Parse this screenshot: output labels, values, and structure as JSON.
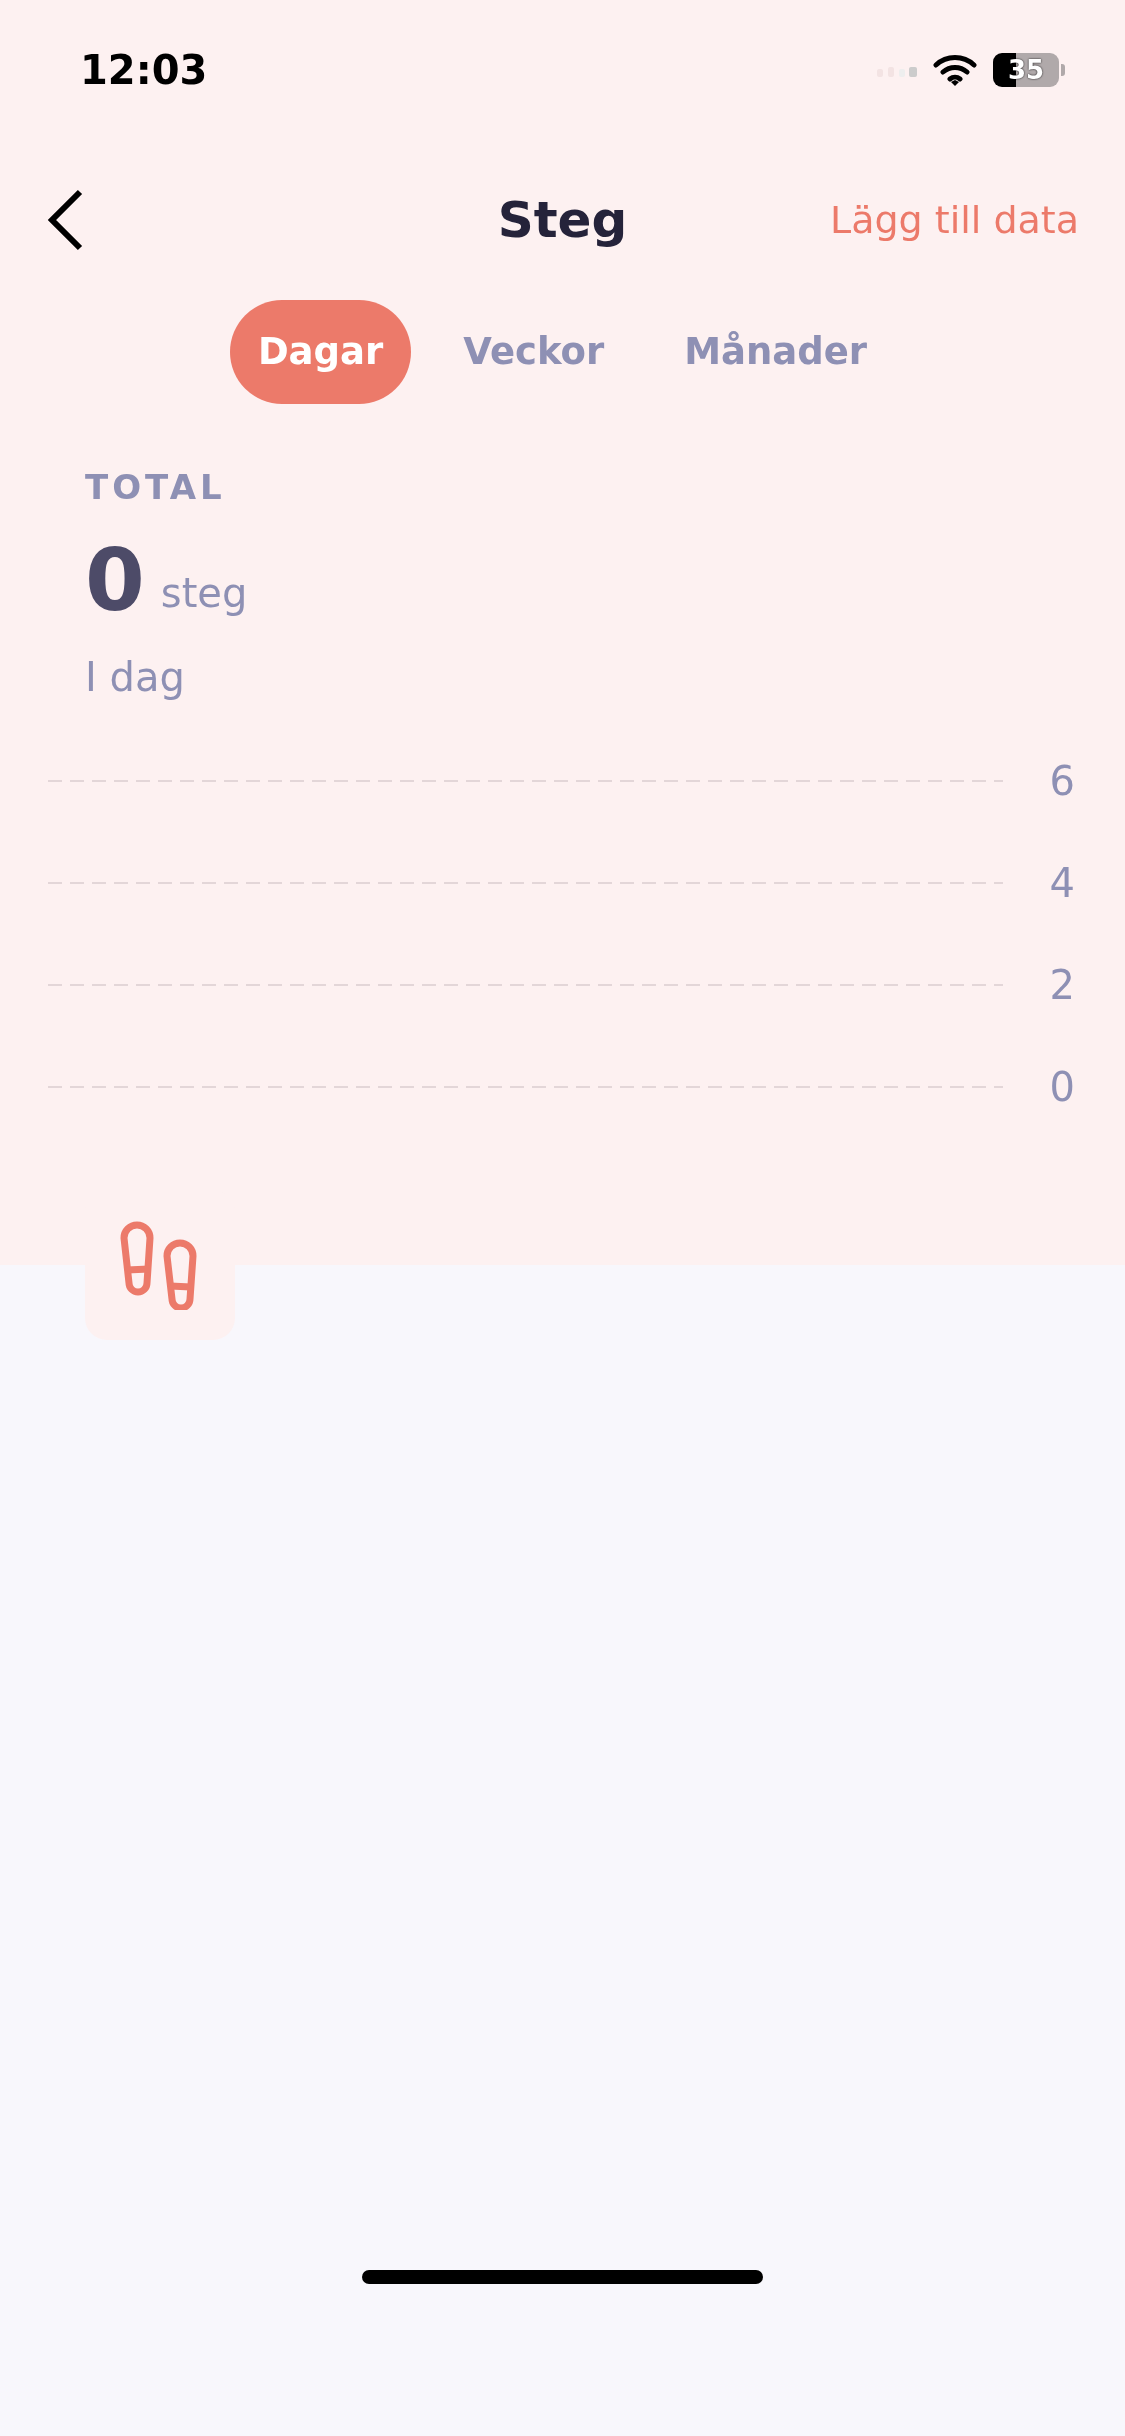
{
  "status_bar": {
    "time": "12:03",
    "battery": "35"
  },
  "header": {
    "title": "Steg",
    "action": "Lägg till data"
  },
  "tabs": [
    {
      "label": "Dagar",
      "selected": true
    },
    {
      "label": "Veckor",
      "selected": false
    },
    {
      "label": "Månader",
      "selected": false
    }
  ],
  "summary": {
    "label": "TOTAL",
    "value": "0",
    "unit": "steg",
    "period": "I dag"
  },
  "chart": {
    "tick_labels": [
      "6",
      "4",
      "2",
      "0"
    ]
  }
}
